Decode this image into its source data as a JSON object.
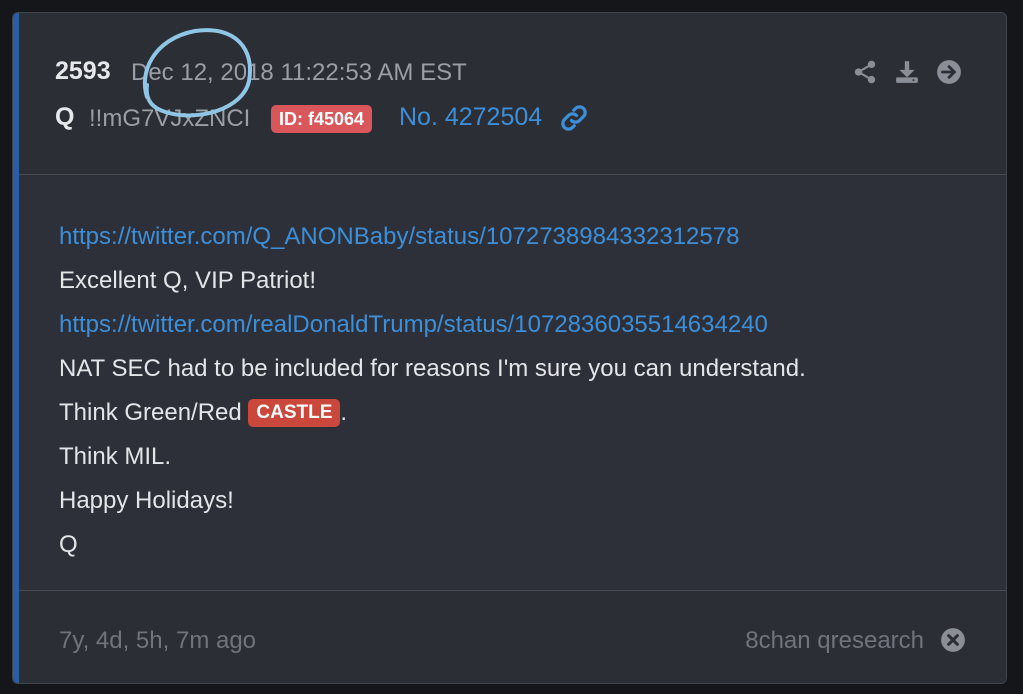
{
  "post": {
    "number": "2593",
    "date": "Dec 12, 2018 11:22:53 AM EST",
    "author": "Q",
    "tripcode": "!!mG7VJxZNCI",
    "id_badge": "ID: f45064",
    "post_no": "No. 4272504"
  },
  "header_icons": [
    "share-icon",
    "download-icon",
    "arrow-right-circle-icon",
    "link-icon"
  ],
  "body": {
    "line1": "https://twitter.com/Q_ANONBaby/status/1072738984332312578",
    "line2": "Excellent Q, VIP Patriot!",
    "line3": "https://twitter.com/realDonaldTrump/status/1072836035514634240",
    "line4": "NAT SEC had to be included for reasons I'm sure you can understand.",
    "line5_prefix": "Think Green/Red ",
    "line5_badge": "CASTLE",
    "line5_suffix": ".",
    "line6": "Think MIL.",
    "line7": "Happy Holidays!",
    "line8": "Q"
  },
  "footer": {
    "timeago": "7y, 4d, 5h, 7m ago",
    "source": "8chan qresearch"
  },
  "colors": {
    "accent": "#2a5ea8",
    "link": "#3d8fd9",
    "id_badge": "#d9565b",
    "castle_badge": "#c9473b",
    "annotation_circle": "#8fc6e6"
  }
}
